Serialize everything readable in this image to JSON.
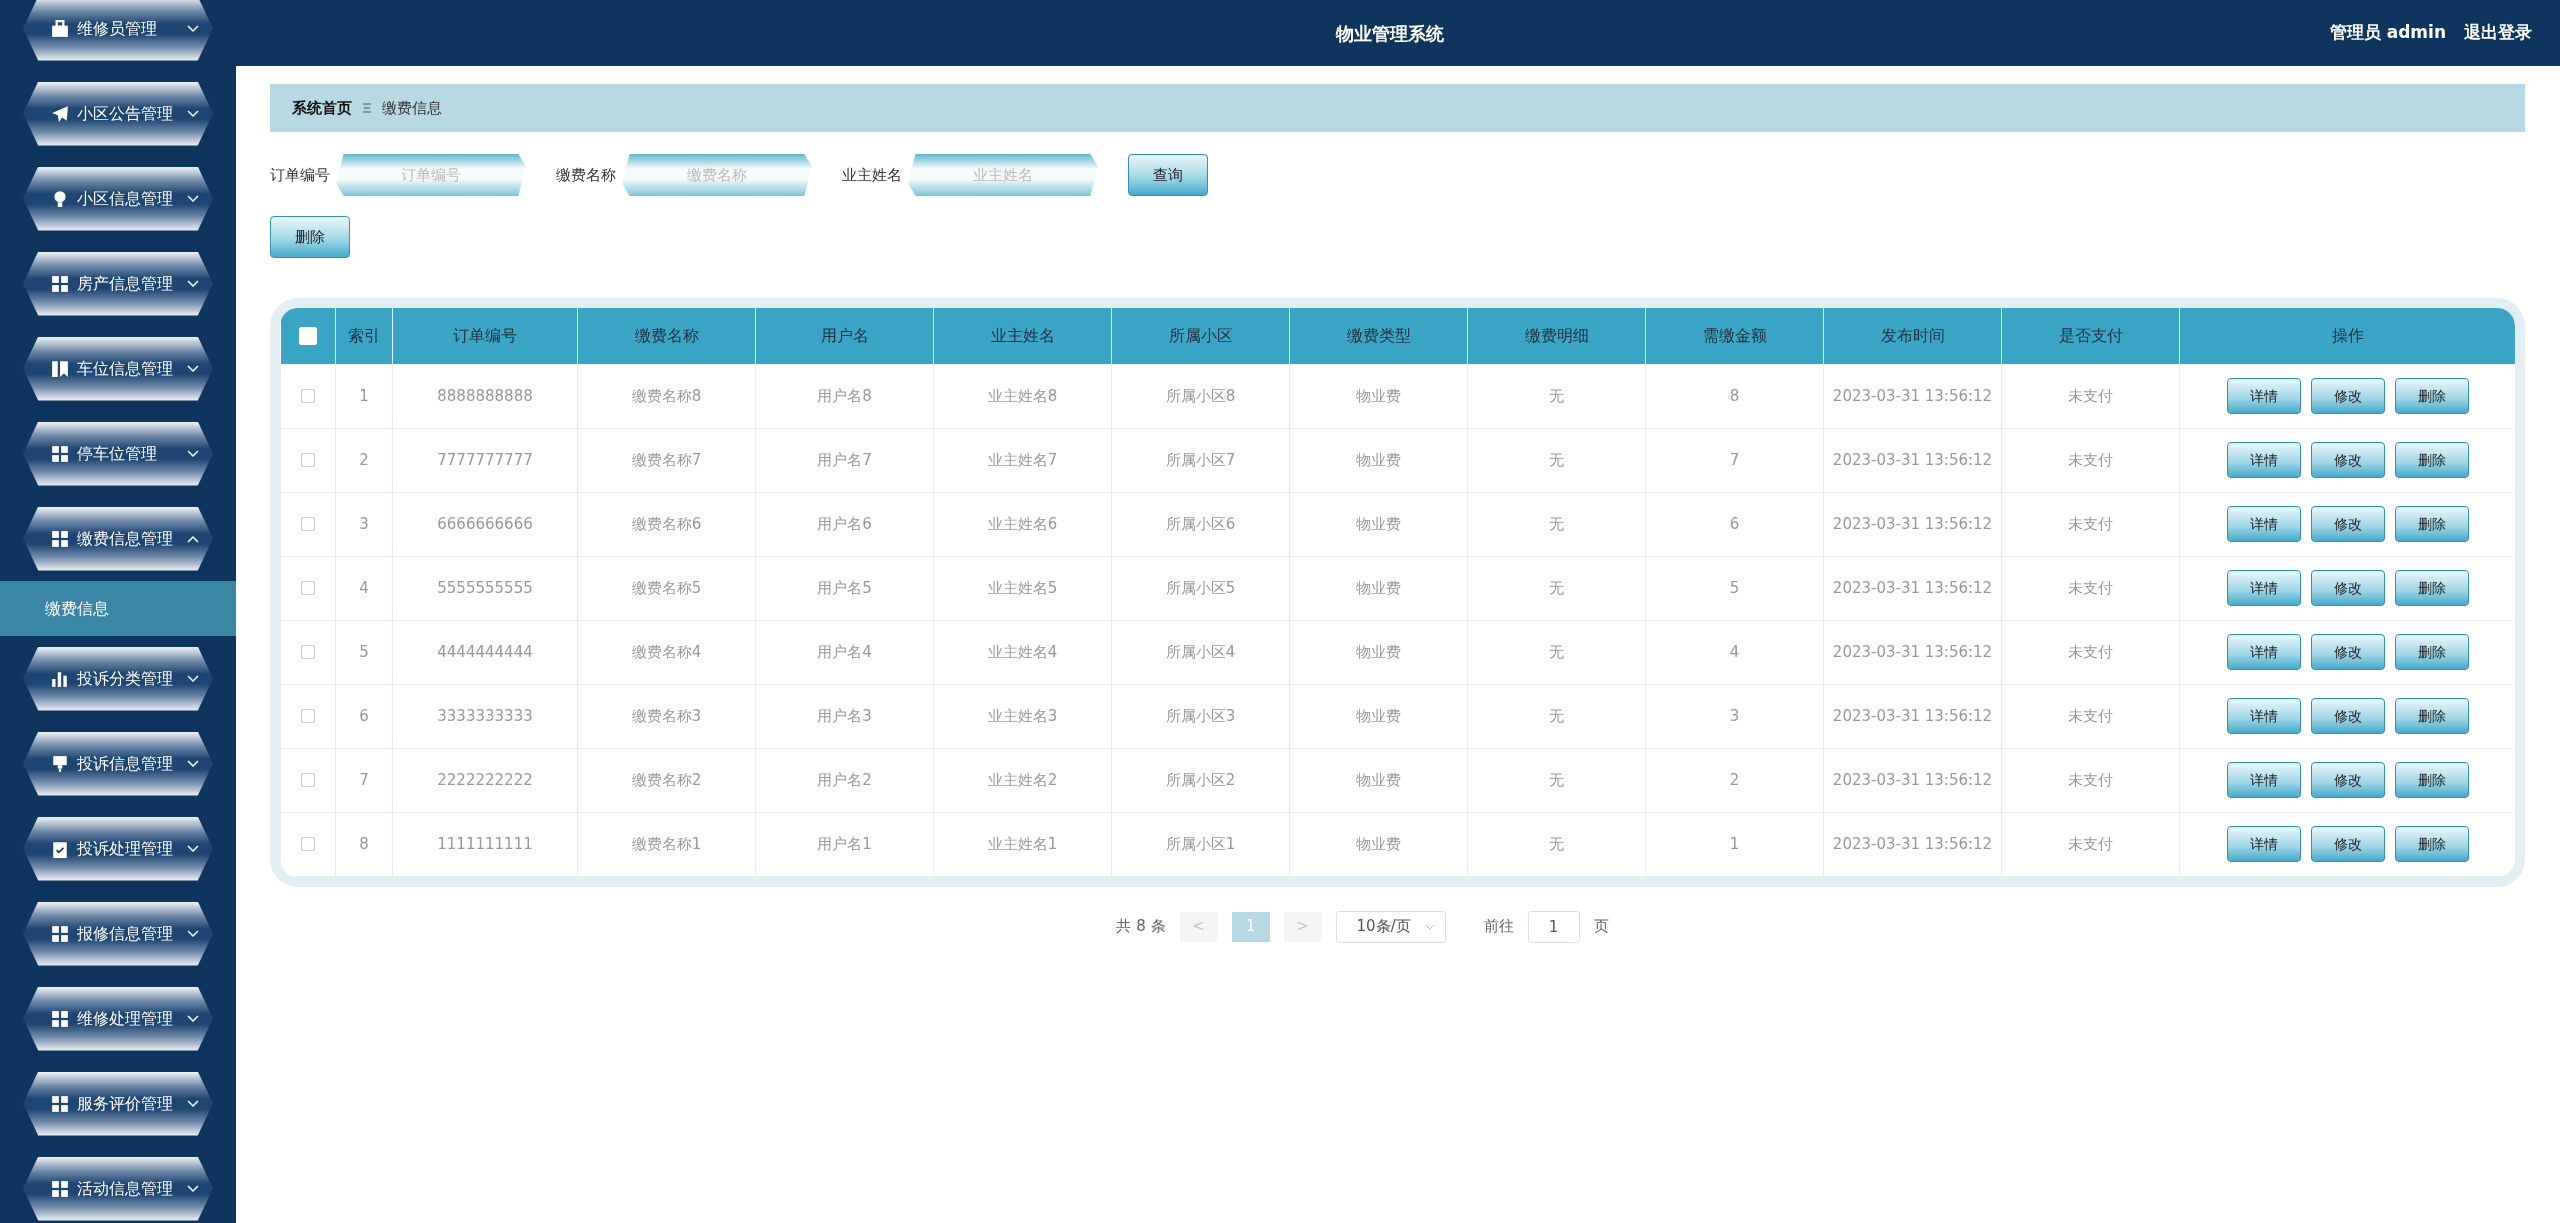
{
  "header": {
    "title": "物业管理系统",
    "user": "管理员 admin",
    "logout": "退出登录"
  },
  "sidebar": {
    "items": [
      {
        "label": "维修员管理",
        "expanded": false
      },
      {
        "label": "小区公告管理",
        "expanded": false
      },
      {
        "label": "小区信息管理",
        "expanded": false
      },
      {
        "label": "房产信息管理",
        "expanded": false
      },
      {
        "label": "车位信息管理",
        "expanded": false
      },
      {
        "label": "停车位管理",
        "expanded": false
      },
      {
        "label": "缴费信息管理",
        "expanded": true,
        "children": [
          {
            "label": "缴费信息",
            "selected": true
          }
        ]
      },
      {
        "label": "投诉分类管理",
        "expanded": false
      },
      {
        "label": "投诉信息管理",
        "expanded": false
      },
      {
        "label": "投诉处理管理",
        "expanded": false
      },
      {
        "label": "报修信息管理",
        "expanded": false
      },
      {
        "label": "维修处理管理",
        "expanded": false
      },
      {
        "label": "服务评价管理",
        "expanded": false
      },
      {
        "label": "活动信息管理",
        "expanded": false
      }
    ]
  },
  "breadcrumb": [
    "系统首页",
    "缴费信息"
  ],
  "search": {
    "fields": [
      {
        "label": "订单编号",
        "placeholder": "订单编号"
      },
      {
        "label": "缴费名称",
        "placeholder": "缴费名称"
      },
      {
        "label": "业主姓名",
        "placeholder": "业主姓名"
      }
    ],
    "button": "查询"
  },
  "toolbar": {
    "delete": "删除"
  },
  "table": {
    "header_checked": false,
    "columns": [
      "索引",
      "订单编号",
      "缴费名称",
      "用户名",
      "业主姓名",
      "所属小区",
      "缴费类型",
      "缴费明细",
      "需缴金额",
      "发布时间",
      "是否支付",
      "操作"
    ],
    "rows": [
      {
        "checked": false,
        "cells": [
          "1",
          "8888888888",
          "缴费名称8",
          "用户名8",
          "业主姓名8",
          "所属小区8",
          "物业费",
          "无",
          "8",
          "2023-03-31 13:56:12",
          "未支付"
        ],
        "actions": [
          "详情",
          "修改",
          "删除"
        ]
      },
      {
        "checked": false,
        "cells": [
          "2",
          "7777777777",
          "缴费名称7",
          "用户名7",
          "业主姓名7",
          "所属小区7",
          "物业费",
          "无",
          "7",
          "2023-03-31 13:56:12",
          "未支付"
        ],
        "actions": [
          "详情",
          "修改",
          "删除"
        ]
      },
      {
        "checked": false,
        "cells": [
          "3",
          "6666666666",
          "缴费名称6",
          "用户名6",
          "业主姓名6",
          "所属小区6",
          "物业费",
          "无",
          "6",
          "2023-03-31 13:56:12",
          "未支付"
        ],
        "actions": [
          "详情",
          "修改",
          "删除"
        ]
      },
      {
        "checked": false,
        "cells": [
          "4",
          "5555555555",
          "缴费名称5",
          "用户名5",
          "业主姓名5",
          "所属小区5",
          "物业费",
          "无",
          "5",
          "2023-03-31 13:56:12",
          "未支付"
        ],
        "actions": [
          "详情",
          "修改",
          "删除"
        ]
      },
      {
        "checked": false,
        "cells": [
          "5",
          "4444444444",
          "缴费名称4",
          "用户名4",
          "业主姓名4",
          "所属小区4",
          "物业费",
          "无",
          "4",
          "2023-03-31 13:56:12",
          "未支付"
        ],
        "actions": [
          "详情",
          "修改",
          "删除"
        ]
      },
      {
        "checked": false,
        "cells": [
          "6",
          "3333333333",
          "缴费名称3",
          "用户名3",
          "业主姓名3",
          "所属小区3",
          "物业费",
          "无",
          "3",
          "2023-03-31 13:56:12",
          "未支付"
        ],
        "actions": [
          "详情",
          "修改",
          "删除"
        ]
      },
      {
        "checked": false,
        "cells": [
          "7",
          "2222222222",
          "缴费名称2",
          "用户名2",
          "业主姓名2",
          "所属小区2",
          "物业费",
          "无",
          "2",
          "2023-03-31 13:56:12",
          "未支付"
        ],
        "actions": [
          "详情",
          "修改",
          "删除"
        ]
      },
      {
        "checked": false,
        "cells": [
          "8",
          "1111111111",
          "缴费名称1",
          "用户名1",
          "业主姓名1",
          "所属小区1",
          "物业费",
          "无",
          "1",
          "2023-03-31 13:56:12",
          "未支付"
        ],
        "actions": [
          "详情",
          "修改",
          "删除"
        ]
      }
    ]
  },
  "pagination": {
    "total": "共 8 条",
    "prev": "<",
    "pages": [
      {
        "label": "1",
        "selected": true
      }
    ],
    "next": ">",
    "page_size": "10条/页",
    "goto": "前往",
    "goto_value": "1",
    "page_unit": "页"
  }
}
